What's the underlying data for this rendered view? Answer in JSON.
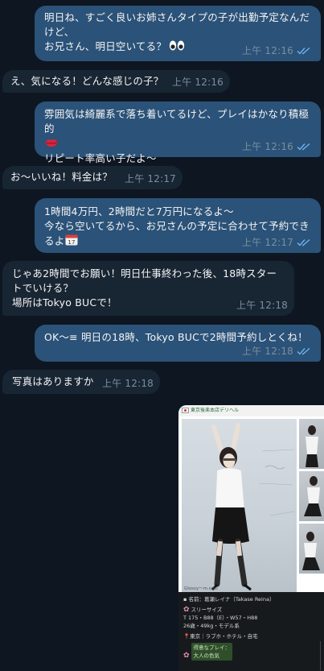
{
  "messages": [
    {
      "id": "m1",
      "dir": "out",
      "text": "明日ね、すごく良いお姉さんタイプの子が出勤予定なんだけど、\nお兄さん、明日空いてる？",
      "emoji": "eyes-emoji",
      "time": "上午 12:16"
    },
    {
      "id": "m2",
      "dir": "in",
      "text": "え、気になる！どんな感じの子？",
      "time": "上午 12:16"
    },
    {
      "id": "m3",
      "dir": "out",
      "text": "雰囲気は綺麗系で落ち着いてるけど、プレイはかなり積極的",
      "emoji": "lips-emoji",
      "text2": "リピート率高い子だよ～",
      "time": "上午 12:16"
    },
    {
      "id": "m4",
      "dir": "in",
      "text": "お～いいね！料金は？",
      "time": "上午 12:17"
    },
    {
      "id": "m5",
      "dir": "out",
      "text": "1時間4万円、2時間だと7万円になるよ～\n今なら空いてるから、お兄さんの予定に合わせて予約できるよ",
      "emoji": "calendar-emoji",
      "time": "上午 12:17"
    },
    {
      "id": "m6",
      "dir": "in",
      "text": "じゃあ2時間でお願い！明日仕事終わった後、18時スタートでいける？\n場所はTokyo BUCで！",
      "time": "上午 12:18"
    },
    {
      "id": "m7",
      "dir": "out",
      "text": "OK～≡ 明日の18時、Tokyo BUCで2時間予約しとくね！",
      "time": "上午 12:18"
    },
    {
      "id": "m8",
      "dir": "in",
      "text": "写真はありますか",
      "time": "上午 12:18"
    }
  ],
  "photo": {
    "header": "東京後楽本店デリヘル",
    "watermark": "Glossy～m.suki",
    "name_row": "名前：葛瀬レイナ（Takase Reina）",
    "three_size_label": "スリーサイズ",
    "three_size_value": "T 175・B88（E）・W57・H88",
    "age_row": "26歳・49kg・モデル系",
    "area_row": "東京｜ラブホ・ホテル・自宅",
    "play_label": "得意なプレイ：",
    "play_value": "大人の色気"
  },
  "colors": {
    "background": "#0e1621",
    "outgoing": "#2b5278",
    "incoming": "#182533",
    "time": "#7d8e9e",
    "read_check": "#6ab3f3"
  }
}
